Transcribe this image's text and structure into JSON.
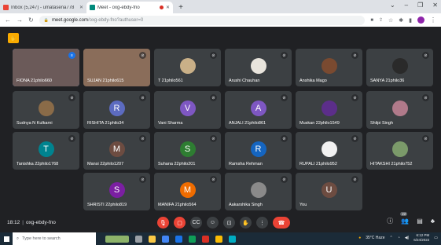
{
  "browser": {
    "tabs": [
      {
        "title": "Inbox (5,247) - umatasena778",
        "favicon_color": "#ea4335",
        "active": false
      },
      {
        "title": "Meet - oxg-ebdy-fno",
        "favicon_color": "#00897b",
        "active": true
      }
    ],
    "url_host": "meet.google.com",
    "url_path": "/oxg-ebdy-fno?authuser=0"
  },
  "meeting": {
    "time": "18:12",
    "code": "oxg-ebdy-fno",
    "participant_count": "22"
  },
  "participants": [
    {
      "name": "FIONA 21philo660",
      "kind": "video",
      "bg": "#6b5a59",
      "speaking": true
    },
    {
      "name": "SUJAN 21philo615",
      "kind": "video",
      "bg": "#8a6d5a"
    },
    {
      "name": "T 21philo561",
      "kind": "photo",
      "bg": "#c9b088"
    },
    {
      "name": "Arushi Chauhan",
      "kind": "photo",
      "bg": "#e8e4dc"
    },
    {
      "name": "Anshika Mago",
      "kind": "photo",
      "bg": "#7a4a30"
    },
    {
      "name": "SANYA 21philo36",
      "kind": "photo",
      "bg": "#2a2a2a"
    },
    {
      "name": "Sudnya N Kulkarni",
      "kind": "photo",
      "bg": "#8a6b48"
    },
    {
      "name": "RISHITA 21philo34",
      "kind": "letter",
      "letter": "R",
      "bg": "#5c6bc0"
    },
    {
      "name": "Vani Sharma",
      "kind": "letter",
      "letter": "V",
      "bg": "#7e57c2"
    },
    {
      "name": "ANJALI 21philo861",
      "kind": "letter",
      "letter": "A",
      "bg": "#7e57c2"
    },
    {
      "name": "Muskan 22philo1549",
      "kind": "photo",
      "bg": "#5c2e8a"
    },
    {
      "name": "Shilpi Singh",
      "kind": "photo",
      "bg": "#b07a8a"
    },
    {
      "name": "Tanishka 22philo1768",
      "kind": "letter",
      "letter": "T",
      "bg": "#00838f"
    },
    {
      "name": "Mansi 22philo1207",
      "kind": "letter",
      "letter": "M",
      "bg": "#6d4c41"
    },
    {
      "name": "Suhana 22philo201",
      "kind": "letter",
      "letter": "S",
      "bg": "#2e7d32"
    },
    {
      "name": "Ramsha Rehman",
      "kind": "letter",
      "letter": "R",
      "bg": "#1565c0"
    },
    {
      "name": "RUPALI 21philo952",
      "kind": "photo",
      "bg": "#f1f1f1"
    },
    {
      "name": "HITAKSHI 21philo752",
      "kind": "photo",
      "bg": "#7b9a6a"
    },
    {
      "name": "SHRISTI 22philo819",
      "kind": "letter",
      "letter": "S",
      "bg": "#7b1fa2"
    },
    {
      "name": "MANIFA 21philo564",
      "kind": "letter",
      "letter": "M",
      "bg": "#ef6c00"
    },
    {
      "name": "Aakarshika Singh",
      "kind": "photo",
      "bg": "#8a8a8a"
    },
    {
      "name": "You",
      "kind": "letter",
      "letter": "U",
      "bg": "#6d4c41"
    }
  ],
  "taskbar": {
    "search_placeholder": "Type here to search",
    "weather": "35°C Haze",
    "time": "6:12 PM",
    "date": "6/24/2022"
  }
}
